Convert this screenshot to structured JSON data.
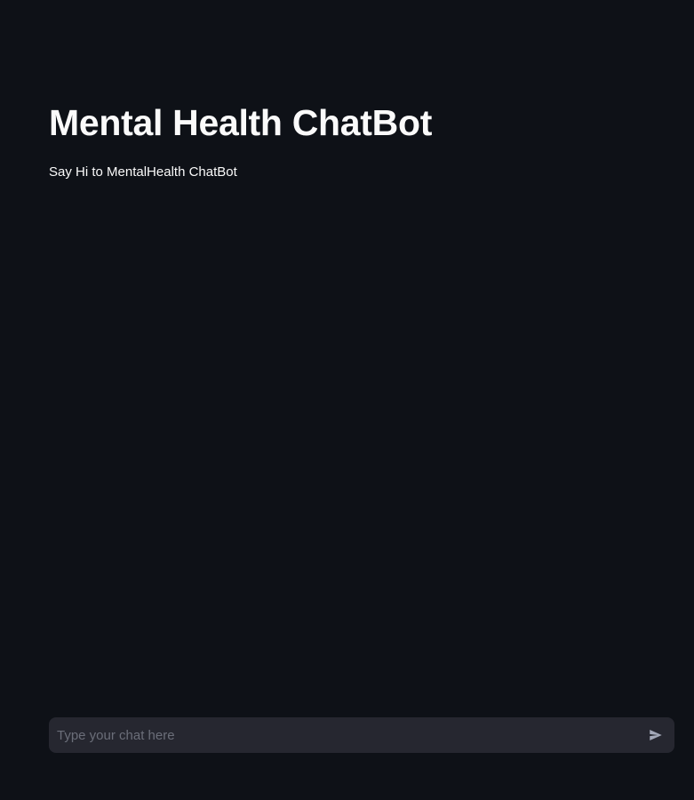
{
  "header": {
    "title": "Mental Health ChatBot",
    "subtitle": "Say Hi to MentalHealth ChatBot"
  },
  "chat": {
    "placeholder": "Type your chat here",
    "value": "",
    "send_icon": "send-icon"
  },
  "colors": {
    "background": "#0e1117",
    "input_background": "#262730",
    "text": "#fafafa",
    "placeholder": "#6b6e79",
    "icon": "#a3a8b8"
  }
}
